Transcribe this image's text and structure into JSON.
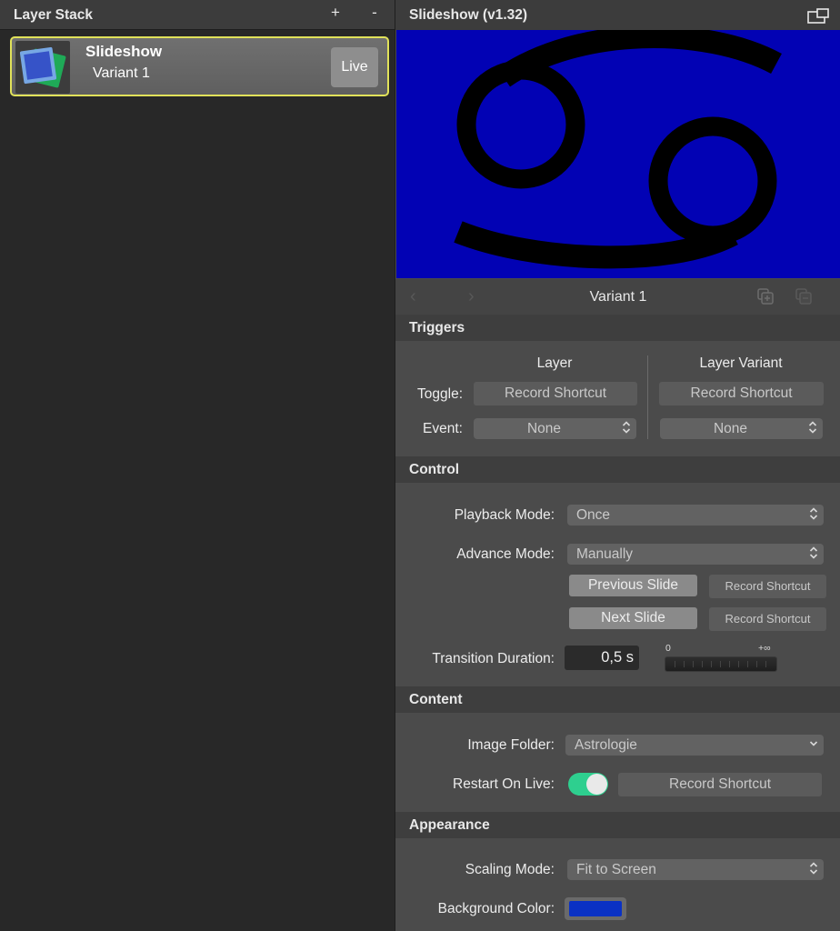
{
  "left_panel": {
    "title": "Layer Stack",
    "add_label": "+",
    "remove_label": "-",
    "layer": {
      "name": "Slideshow",
      "variant": "Variant 1",
      "live_label": "Live"
    }
  },
  "right_panel": {
    "title": "Slideshow (v1.32)",
    "preview_background": "#0202b4",
    "variant_bar": {
      "title": "Variant 1",
      "prev_icon": "chevron-left-icon",
      "next_icon": "chevron-right-icon"
    },
    "triggers": {
      "heading": "Triggers",
      "columns": [
        "Layer",
        "Layer Variant"
      ],
      "toggle_label": "Toggle:",
      "event_label": "Event:",
      "layer_toggle": "Record Shortcut",
      "variant_toggle": "Record Shortcut",
      "layer_event": "None",
      "variant_event": "None"
    },
    "control": {
      "heading": "Control",
      "playback_label": "Playback Mode:",
      "playback_value": "Once",
      "advance_label": "Advance Mode:",
      "advance_value": "Manually",
      "previous_slide": "Previous Slide",
      "previous_shortcut": "Record Shortcut",
      "next_slide": "Next Slide",
      "next_shortcut": "Record Shortcut",
      "duration_label": "Transition Duration:",
      "duration_value": "0,5 s",
      "slider_min": "0",
      "slider_max": "+∞"
    },
    "content": {
      "heading": "Content",
      "folder_label": "Image Folder:",
      "folder_value": "Astrologie",
      "restart_label": "Restart On Live:",
      "restart_on": true,
      "restart_shortcut": "Record Shortcut"
    },
    "appearance": {
      "heading": "Appearance",
      "scaling_label": "Scaling Mode:",
      "scaling_value": "Fit to Screen",
      "bg_label": "Background Color:",
      "bg_color": "#0a31c4"
    }
  }
}
